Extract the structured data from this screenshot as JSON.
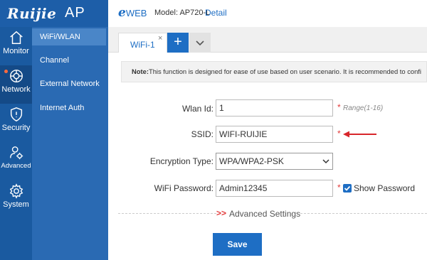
{
  "brand": {
    "logo": "Ruijie",
    "product": "AP"
  },
  "header": {
    "eweb_prefix": "e",
    "eweb_text": "WEB",
    "model": "Model: AP720-L",
    "detail": "Detail"
  },
  "nav": [
    {
      "label": "Monitor",
      "icon": "home-icon"
    },
    {
      "label": "Network",
      "icon": "network-icon"
    },
    {
      "label": "Security",
      "icon": "shield-icon"
    },
    {
      "label": "Advanced",
      "icon": "advanced-user-icon"
    },
    {
      "label": "System",
      "icon": "gear-icon"
    }
  ],
  "subnav": [
    {
      "label": "WiFi/WLAN"
    },
    {
      "label": "Channel"
    },
    {
      "label": "External Network"
    },
    {
      "label": "Internet Auth"
    }
  ],
  "tabs": {
    "active": "WiFi-1",
    "close": "×",
    "add": "+"
  },
  "note": {
    "prefix": "Note:",
    "text": "This function is designed for ease of use based on user scenario. It is recommended to confi"
  },
  "form": {
    "wlan_id_label": "Wlan Id:",
    "wlan_id_value": "1",
    "wlan_id_hint": "Range(1-16)",
    "ssid_label": "SSID:",
    "ssid_value": "WIFI-RUIJIE",
    "encryption_label": "Encryption Type:",
    "encryption_value": "WPA/WPA2-PSK",
    "password_label": "WiFi Password:",
    "password_value": "Admin12345",
    "show_password_label": "Show Password",
    "show_password_checked": true,
    "required_mark": "*"
  },
  "advanced": {
    "arrows": ">>",
    "label": "Advanced Settings"
  },
  "save_label": "Save",
  "colors": {
    "sidebar": "#1a5aa0",
    "accent": "#1e6ec4",
    "required": "#e23a3a"
  }
}
